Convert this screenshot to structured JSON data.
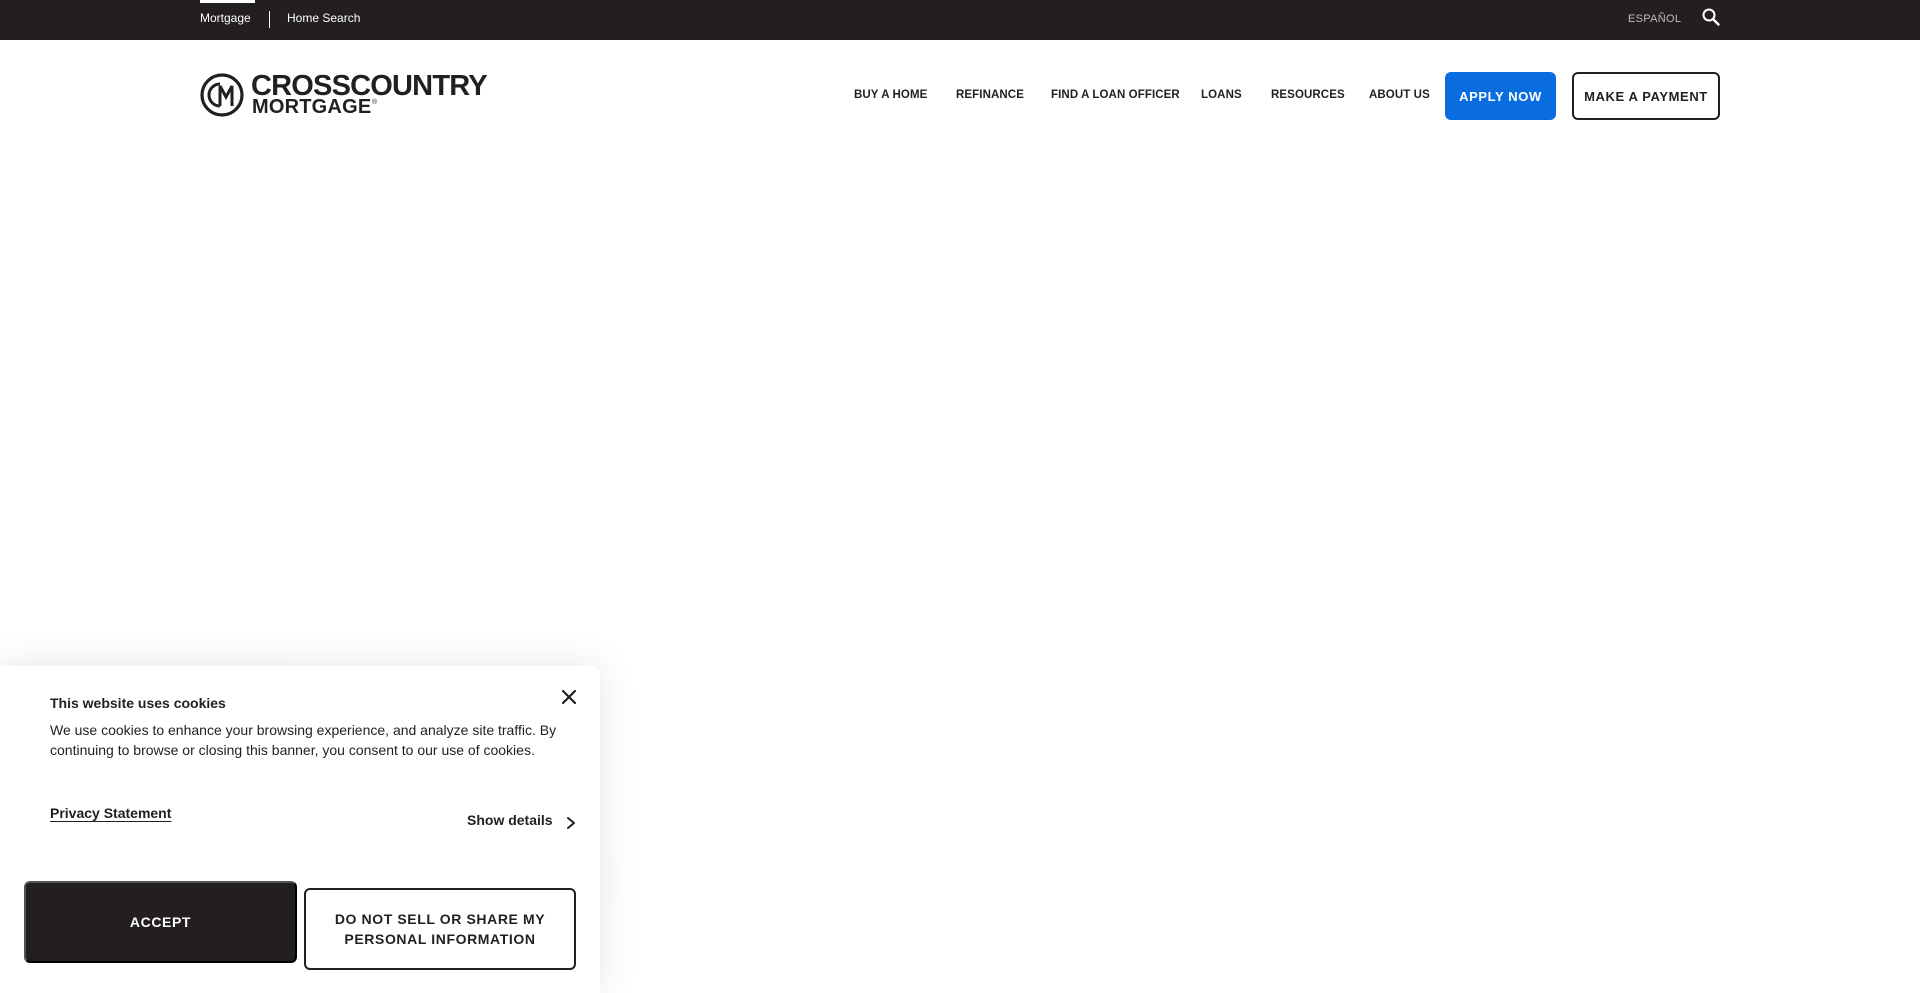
{
  "topbar": {
    "tabs": [
      {
        "label": "Mortgage",
        "active": true
      },
      {
        "label": "Home Search",
        "active": false
      }
    ],
    "language_link": "ESPAÑOL",
    "search_icon": "search-icon"
  },
  "header": {
    "logo": {
      "line1": "CROSSCOUNTRY",
      "line2": "MORTGAGE",
      "registered": "®"
    },
    "nav": [
      {
        "label": "BUY A HOME"
      },
      {
        "label": "REFINANCE"
      },
      {
        "label": "FIND A LOAN OFFICER"
      },
      {
        "label": "LOANS"
      },
      {
        "label": "RESOURCES"
      },
      {
        "label": "ABOUT US"
      }
    ],
    "apply_button": "APPLY NOW",
    "payment_button": "MAKE A PAYMENT"
  },
  "cookie_banner": {
    "title": "This website uses cookies",
    "body": "We use cookies to enhance your browsing experience, and analyze site traffic. By continuing to browse or closing this banner, you consent to our use of cookies.",
    "privacy_link": "Privacy Statement",
    "show_details": "Show details",
    "accept_button": "ACCEPT",
    "do_not_sell_button": "DO NOT SELL OR SHARE MY PERSONAL INFORMATION"
  },
  "colors": {
    "topbar_bg": "#231f20",
    "text_dark": "#231f20",
    "apply_blue": "#0a6ddf",
    "white": "#ffffff"
  }
}
